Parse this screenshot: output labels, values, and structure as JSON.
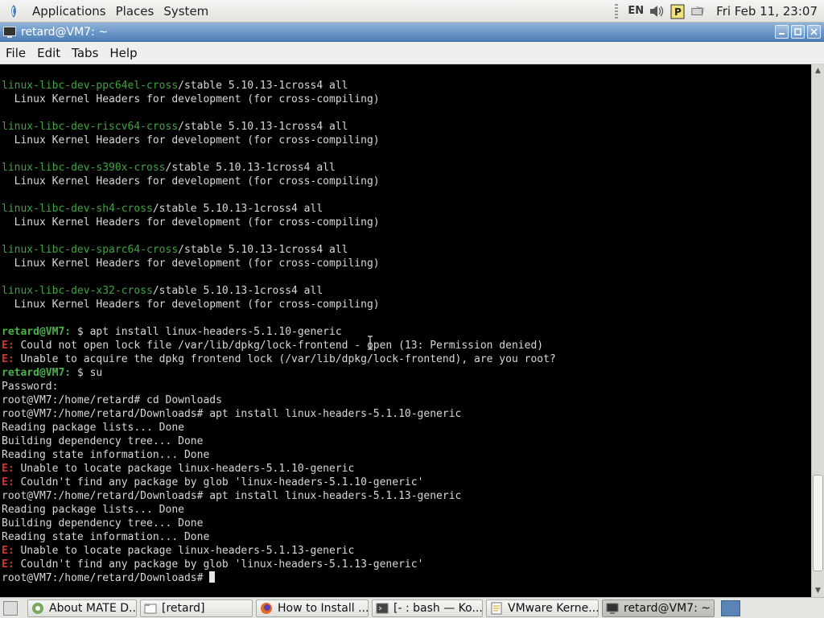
{
  "top_panel": {
    "menus": [
      "Applications",
      "Places",
      "System"
    ],
    "keyboard_layout": "EN",
    "clock": "Fri Feb 11, 23:07"
  },
  "window": {
    "title": "retard@VM7: ~"
  },
  "menubar": [
    "File",
    "Edit",
    "Tabs",
    "Help"
  ],
  "terminal": {
    "lines": [
      {
        "pkg": "linux-libc-dev-ppc64el-cross",
        "rest": "/stable 5.10.13-1cross4 all"
      },
      {
        "text": "  Linux Kernel Headers for development (for cross-compiling)"
      },
      {
        "text": ""
      },
      {
        "pkg": "linux-libc-dev-riscv64-cross",
        "rest": "/stable 5.10.13-1cross4 all"
      },
      {
        "text": "  Linux Kernel Headers for development (for cross-compiling)"
      },
      {
        "text": ""
      },
      {
        "pkg": "linux-libc-dev-s390x-cross",
        "rest": "/stable 5.10.13-1cross4 all"
      },
      {
        "text": "  Linux Kernel Headers for development (for cross-compiling)"
      },
      {
        "text": ""
      },
      {
        "pkg": "linux-libc-dev-sh4-cross",
        "rest": "/stable 5.10.13-1cross4 all"
      },
      {
        "text": "  Linux Kernel Headers for development (for cross-compiling)"
      },
      {
        "text": ""
      },
      {
        "pkg": "linux-libc-dev-sparc64-cross",
        "rest": "/stable 5.10.13-1cross4 all"
      },
      {
        "text": "  Linux Kernel Headers for development (for cross-compiling)"
      },
      {
        "text": ""
      },
      {
        "pkg": "linux-libc-dev-x32-cross",
        "rest": "/stable 5.10.13-1cross4 all"
      },
      {
        "text": "  Linux Kernel Headers for development (for cross-compiling)"
      },
      {
        "text": ""
      },
      {
        "prompt": "retard@VM7:",
        "rest": " $ apt install linux-headers-5.1.10-generic"
      },
      {
        "err": "E:",
        "rest": " Could not open lock file /var/lib/dpkg/lock-frontend - open (13: Permission denied)"
      },
      {
        "err": "E:",
        "rest": " Unable to acquire the dpkg frontend lock (/var/lib/dpkg/lock-frontend), are you root?"
      },
      {
        "prompt": "retard@VM7:",
        "rest": " $ su"
      },
      {
        "text": "Password:"
      },
      {
        "text": "root@VM7:/home/retard# cd Downloads"
      },
      {
        "text": "root@VM7:/home/retard/Downloads# apt install linux-headers-5.1.10-generic"
      },
      {
        "text": "Reading package lists... Done"
      },
      {
        "text": "Building dependency tree... Done"
      },
      {
        "text": "Reading state information... Done"
      },
      {
        "err": "E:",
        "rest": " Unable to locate package linux-headers-5.1.10-generic"
      },
      {
        "err": "E:",
        "rest": " Couldn't find any package by glob 'linux-headers-5.1.10-generic'"
      },
      {
        "text": "root@VM7:/home/retard/Downloads# apt install linux-headers-5.1.13-generic"
      },
      {
        "text": "Reading package lists... Done"
      },
      {
        "text": "Building dependency tree... Done"
      },
      {
        "text": "Reading state information... Done"
      },
      {
        "err": "E:",
        "rest": " Unable to locate package linux-headers-5.1.13-generic"
      },
      {
        "err": "E:",
        "rest": " Couldn't find any package by glob 'linux-headers-5.1.13-generic'"
      },
      {
        "text": "root@VM7:/home/retard/Downloads# ",
        "cursor": true
      }
    ]
  },
  "taskbar": {
    "tasks": [
      {
        "label": "About MATE D...",
        "icon": "mate-about-icon"
      },
      {
        "label": "[retard]",
        "icon": "folder-icon"
      },
      {
        "label": "How to Install ...",
        "icon": "firefox-icon"
      },
      {
        "label": "[- : bash — Ko...",
        "icon": "konsole-icon"
      },
      {
        "label": "VMware Kerne...",
        "icon": "pluma-icon"
      },
      {
        "label": "retard@VM7: ~",
        "icon": "terminal-icon",
        "active": true
      }
    ]
  },
  "colors": {
    "terminal_bg": "#000000",
    "terminal_fg": "#d8d8d8",
    "package_green": "#3fa43f",
    "prompt_green": "#46b346",
    "error_red": "#cc3333",
    "titlebar_blue": "#4d7fb7"
  }
}
